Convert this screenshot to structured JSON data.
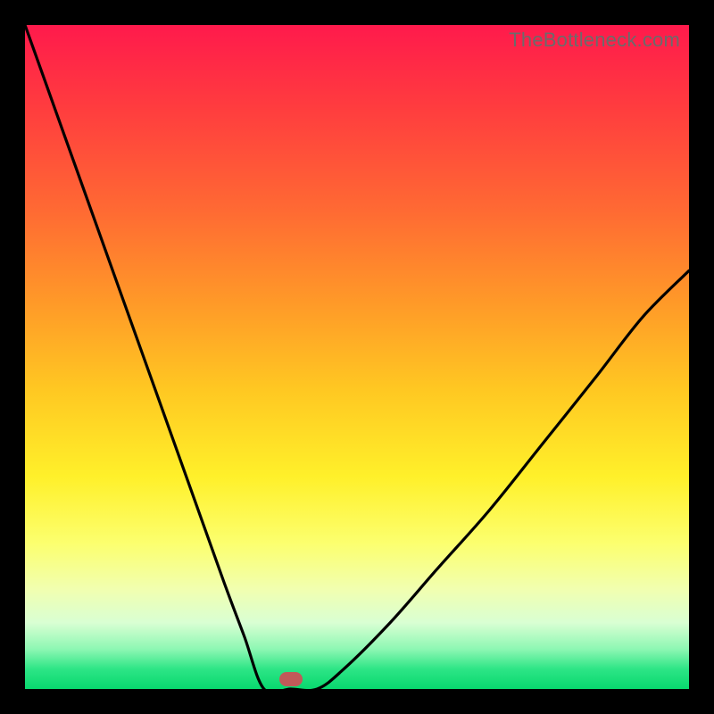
{
  "watermark": "TheBottleneck.com",
  "colors": {
    "frame": "#000000",
    "curve": "#000000",
    "marker": "#c15a59",
    "gradient_stops": [
      {
        "offset": 0.0,
        "color": "#ff1a4c"
      },
      {
        "offset": 0.12,
        "color": "#ff3b3f"
      },
      {
        "offset": 0.28,
        "color": "#ff6a33"
      },
      {
        "offset": 0.42,
        "color": "#ff9a28"
      },
      {
        "offset": 0.55,
        "color": "#ffc822"
      },
      {
        "offset": 0.68,
        "color": "#fff02a"
      },
      {
        "offset": 0.78,
        "color": "#fcff6e"
      },
      {
        "offset": 0.85,
        "color": "#f1ffb0"
      },
      {
        "offset": 0.9,
        "color": "#d9ffd3"
      },
      {
        "offset": 0.94,
        "color": "#8df7b3"
      },
      {
        "offset": 0.97,
        "color": "#2de586"
      },
      {
        "offset": 1.0,
        "color": "#08d86e"
      }
    ]
  },
  "chart_data": {
    "type": "line",
    "title": "",
    "xlabel": "",
    "ylabel": "",
    "xlim": [
      0,
      1
    ],
    "ylim": [
      0,
      1
    ],
    "marker": {
      "x": 0.4,
      "y": 0.015
    },
    "flat_segment": {
      "x_start": 0.36,
      "x_end": 0.44,
      "y": 0.0
    },
    "series": [
      {
        "name": "curve",
        "x": [
          0.0,
          0.05,
          0.1,
          0.15,
          0.2,
          0.25,
          0.3,
          0.33,
          0.36,
          0.4,
          0.44,
          0.48,
          0.55,
          0.62,
          0.7,
          0.78,
          0.86,
          0.93,
          1.0
        ],
        "y": [
          1.0,
          0.86,
          0.72,
          0.58,
          0.44,
          0.3,
          0.16,
          0.08,
          0.0,
          0.0,
          0.0,
          0.03,
          0.1,
          0.18,
          0.27,
          0.37,
          0.47,
          0.56,
          0.63
        ]
      }
    ]
  }
}
